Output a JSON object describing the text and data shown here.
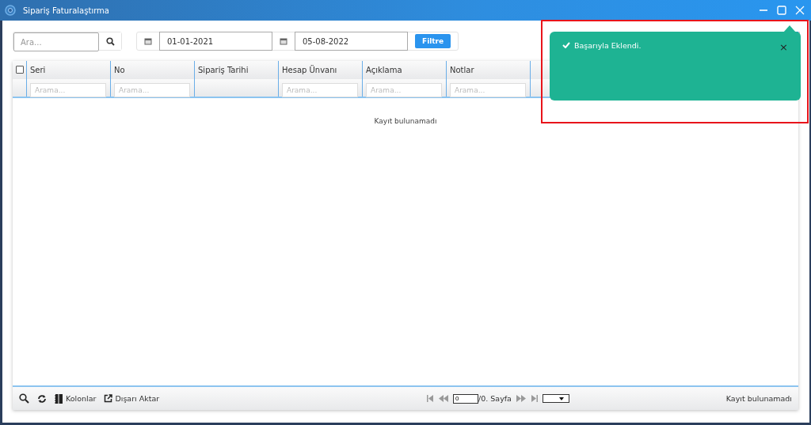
{
  "window": {
    "title": "Sipariş Faturalaştırma"
  },
  "toolbar": {
    "search": {
      "placeholder": "Ara..."
    },
    "date_from": "01-01-2021",
    "date_to": "05-08-2022",
    "filter_button": "Filtre"
  },
  "table": {
    "select_all": {
      "checked": false
    },
    "columns": [
      {
        "label": "Seri",
        "filter_placeholder": "Arama..."
      },
      {
        "label": "No",
        "filter_placeholder": "Arama..."
      },
      {
        "label": "Sipariş Tarihi"
      },
      {
        "label": "Hesap Ünvanı",
        "filter_placeholder": "Arama..."
      },
      {
        "label": "Açıklama",
        "filter_placeholder": "Arama..."
      },
      {
        "label": "Notlar",
        "filter_placeholder": "Arama..."
      }
    ],
    "empty_message": "Kayıt bulunamadı"
  },
  "footer": {
    "columns_button": "Kolonlar",
    "export_button": "Dışarı Aktar",
    "page_input": "0",
    "page_label": "/0. Sayfa",
    "status": "Kayıt bulunamadı"
  },
  "toast": {
    "message": "Başarıyla Eklendi.",
    "close": "×"
  }
}
